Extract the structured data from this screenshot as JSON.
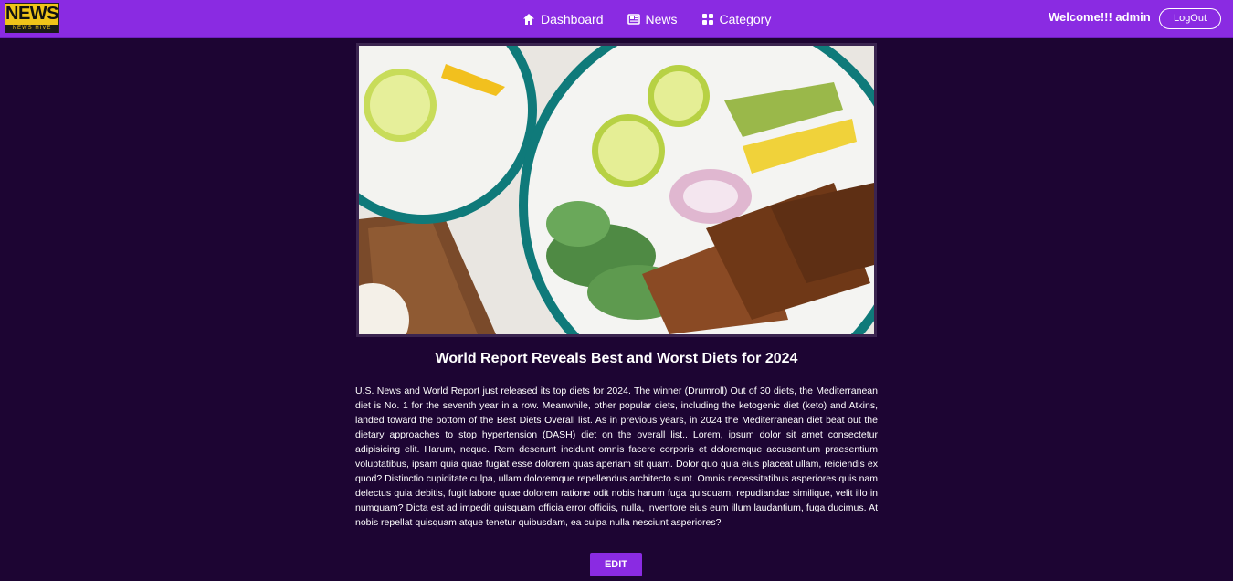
{
  "logo": {
    "top_text": "NEWS",
    "bottom_text": "NEWS HIVE"
  },
  "nav": {
    "links": [
      {
        "label": "Dashboard",
        "icon": "home-icon"
      },
      {
        "label": "News",
        "icon": "newspaper-icon"
      },
      {
        "label": "Category",
        "icon": "grid-icon"
      }
    ],
    "welcome": "Welcome!!! admin",
    "logout_label": "LogOut"
  },
  "article": {
    "image_description_icon": "food-plate-image",
    "title": "World Report Reveals Best and Worst Diets for 2024",
    "body": "U.S. News and World Report just released its top diets for 2024. The winner (Drumroll) Out of 30 diets, the Mediterranean diet is No. 1 for the seventh year in a row. Meanwhile, other popular diets, including the ketogenic diet (keto) and Atkins, landed toward the bottom of the Best Diets Overall list. As in previous years, in 2024 the Mediterranean diet beat out the dietary approaches to stop hypertension (DASH) diet on the overall list.. Lorem, ipsum dolor sit amet consectetur adipisicing elit. Harum, neque. Rem deserunt incidunt omnis facere corporis et doloremque accusantium praesentium voluptatibus, ipsam quia quae fugiat esse dolorem quas aperiam sit quam. Dolor quo quia eius placeat ullam, reiciendis ex quod? Distinctio cupiditate culpa, ullam doloremque repellendus architecto sunt. Omnis necessitatibus asperiores quis nam delectus quia debitis, fugit labore quae dolorem ratione odit nobis harum fuga quisquam, repudiandae similique, velit illo in numquam? Dicta est ad impedit quisquam officia error officiis, nulla, inventore eius eum illum laudantium, fuga ducimus. At nobis repellat quisquam atque tenetur quibusdam, ea culpa nulla nesciunt asperiores?",
    "edit_label": "EDIT"
  },
  "colors": {
    "navbar": "#8a2be2",
    "background": "#1d0533",
    "button": "#8a2be2"
  }
}
